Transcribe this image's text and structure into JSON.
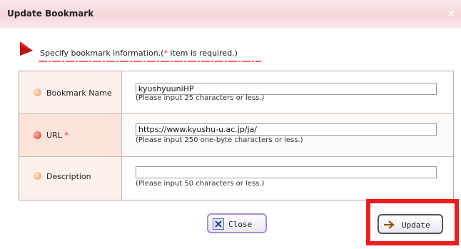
{
  "dialog": {
    "title": "Update Bookmark",
    "close_glyph": "×"
  },
  "instruction": {
    "text_before": "Specify bookmark information.(",
    "required_mark": "*",
    "text_after": " item is required.)"
  },
  "fields": [
    {
      "label": "Bookmark Name",
      "required": false,
      "value": "kyushyuuniHP",
      "hint": "(Please input 25 characters or less.)"
    },
    {
      "label": "URL",
      "required": true,
      "required_mark": "*",
      "value": "https://www.kyushu-u.ac.jp/ja/",
      "hint": "(Please input 250 one-byte characters or less.)"
    },
    {
      "label": "Description",
      "required": false,
      "value": "",
      "hint": "(Please input 50 characters or less.)"
    }
  ],
  "buttons": {
    "close_label": "Close",
    "update_label": "Update"
  },
  "icons": {
    "close_button_icon": "x-box-icon",
    "update_button_icon": "arrow-right-icon",
    "instruction_icon": "red-flag-icon"
  },
  "colors": {
    "required": "#d62020",
    "highlight_frame": "#ee1c1c",
    "title_bar": "#f7d6d8"
  }
}
